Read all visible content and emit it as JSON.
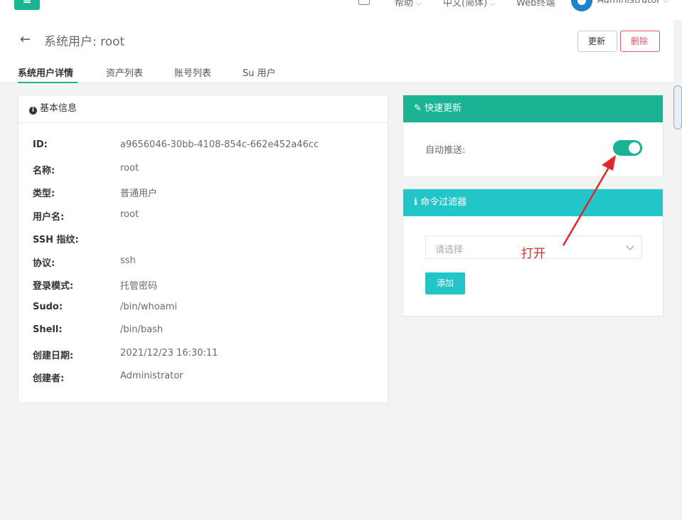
{
  "topbar": {
    "help": "帮助",
    "language": "中文(简体)",
    "web_terminal": "Web终端",
    "user": "Administrator"
  },
  "header": {
    "title": "系统用户: root",
    "update_label": "更新",
    "delete_label": "删除",
    "tabs": [
      {
        "label": "系统用户详情"
      },
      {
        "label": "资产列表"
      },
      {
        "label": "账号列表"
      },
      {
        "label": "Su 用户"
      }
    ]
  },
  "basic_info": {
    "title": "基本信息",
    "rows": [
      {
        "key": "ID:",
        "value": "a9656046-30bb-4108-854c-662e452a46cc"
      },
      {
        "key": "名称:",
        "value": "root"
      },
      {
        "key": "类型:",
        "value": "普通用户"
      },
      {
        "key": "用户名:",
        "value": "root"
      },
      {
        "key": "SSH 指纹:",
        "value": ""
      },
      {
        "key": "协议:",
        "value": "ssh"
      },
      {
        "key": "登录模式:",
        "value": "托管密码"
      },
      {
        "key": "Sudo:",
        "value": "/bin/whoami"
      },
      {
        "key": "Shell:",
        "value": "/bin/bash"
      },
      {
        "key": "创建日期:",
        "value": "2021/12/23 16:30:11"
      },
      {
        "key": "创建者:",
        "value": "Administrator"
      }
    ]
  },
  "quick_update": {
    "title": "快速更新",
    "auto_push_label": "自动推送:",
    "auto_push_enabled": true
  },
  "command_filter": {
    "title": "命令过滤器",
    "placeholder": "请选择",
    "add_label": "添加"
  },
  "annotation": {
    "text": "打开",
    "color": "#e0272a"
  },
  "colors": {
    "primary": "#1ab394",
    "info": "#23c6c8",
    "danger": "#ed5565"
  }
}
